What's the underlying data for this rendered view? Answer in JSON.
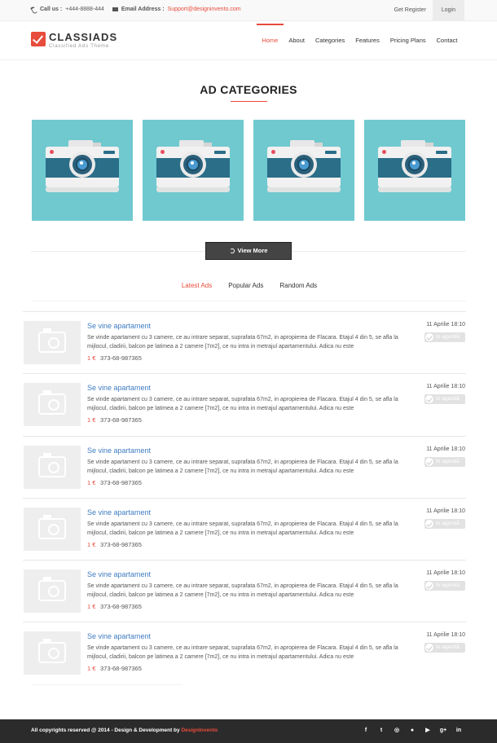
{
  "topbar": {
    "call_label": "Call us :",
    "call_value": "+444-8888-444",
    "email_label": "Email Address :",
    "email_value": "Support@designinvento.com",
    "register": "Get Register",
    "login": "Login"
  },
  "logo": {
    "brand_a": "CLASSI",
    "brand_b": "ADS",
    "tagline": "Classified Ads Theme"
  },
  "nav": {
    "items": [
      "Home",
      "About",
      "Categories",
      "Features",
      "Pricing Plans",
      "Contact"
    ],
    "active": "Home"
  },
  "categories": {
    "title": "AD CATEGORIES",
    "tile_icon": "camera-icon",
    "view_more": "View More"
  },
  "tabs": {
    "items": [
      "Latest Ads",
      "Popular Ads",
      "Random Ads"
    ],
    "active": "Latest Ads"
  },
  "listings": [
    {
      "title": "Se vine apartament",
      "desc": "Se vinde apartament cu 3 camere, ce au intrare separat, suprafata 67m2, in apropierea de Flacara. Etajul 4 din 5, se afla la mijlocul, cladirii, balcon pe latimea a 2 camere [7m2], ce nu intra in metrajul apartamentului. Adica nu este",
      "price": "1 €",
      "phone": "373-68-987365",
      "date": "11 Aprilie 18:10",
      "status": "In agendă"
    },
    {
      "title": "Se vine apartament",
      "desc": "Se vinde apartament cu 3 camere, ce au intrare separat, suprafata 67m2, in apropierea de Flacara. Etajul 4 din 5, se afla la mijlocul, cladirii, balcon pe latimea a 2 camere [7m2], ce nu intra in metrajul apartamentului. Adica nu este",
      "price": "1 €",
      "phone": "373-68-987365",
      "date": "11 Aprilie 18:10",
      "status": "In agendă"
    },
    {
      "title": "Se vine apartament",
      "desc": "Se vinde apartament cu 3 camere, ce au intrare separat, suprafata 67m2, in apropierea de Flacara. Etajul 4 din 5, se afla la mijlocul, cladirii, balcon pe latimea a 2 camere [7m2], ce nu intra in metrajul apartamentului. Adica nu este",
      "price": "1 €",
      "phone": "373-68-987365",
      "date": "11 Aprilie 18:10",
      "status": "In agendă"
    },
    {
      "title": "Se vine apartament",
      "desc": "Se vinde apartament cu 3 camere, ce au intrare separat, suprafata 67m2, in apropierea de Flacara. Etajul 4 din 5, se afla la mijlocul, cladirii, balcon pe latimea a 2 camere [7m2], ce nu intra in metrajul apartamentului. Adica nu este",
      "price": "1 €",
      "phone": "373-68-987365",
      "date": "11 Aprilie 18:10",
      "status": "In agendă"
    },
    {
      "title": "Se vine apartament",
      "desc": "Se vinde apartament cu 3 camere, ce au intrare separat, suprafata 67m2, in apropierea de Flacara. Etajul 4 din 5, se afla la mijlocul, cladirii, balcon pe latimea a 2 camere [7m2], ce nu intra in metrajul apartamentului. Adica nu este",
      "price": "1 €",
      "phone": "373-68-987365",
      "date": "11 Aprilie 18:10",
      "status": "In agendă"
    },
    {
      "title": "Se vine apartament",
      "desc": "Se vinde apartament cu 3 camere, ce au intrare separat, suprafata 67m2, in apropierea de Flacara. Etajul 4 din 5, se afla la mijlocul, cladirii, balcon pe latimea a 2 camere [7m2], ce nu intra in metrajul apartamentului. Adica nu este",
      "price": "1 €",
      "phone": "373-68-987365",
      "date": "11 Aprilie 18:10",
      "status": "In agendă"
    }
  ],
  "footer": {
    "copy": "All copyrights reserved @ 2014 - Design & Development by",
    "brand": "DesignInvento",
    "social": [
      {
        "name": "facebook-icon",
        "glyph": "f"
      },
      {
        "name": "twitter-icon",
        "glyph": "t"
      },
      {
        "name": "dribbble-icon",
        "glyph": "◎"
      },
      {
        "name": "flickr-icon",
        "glyph": "●"
      },
      {
        "name": "youtube-icon",
        "glyph": "▶"
      },
      {
        "name": "googleplus-icon",
        "glyph": "g+"
      },
      {
        "name": "linkedin-icon",
        "glyph": "in"
      }
    ]
  },
  "colors": {
    "accent": "#e74c3c",
    "tile_bg": "#6fc9cf",
    "link": "#3f7cc2",
    "footer_bg": "#2b2b2b"
  }
}
